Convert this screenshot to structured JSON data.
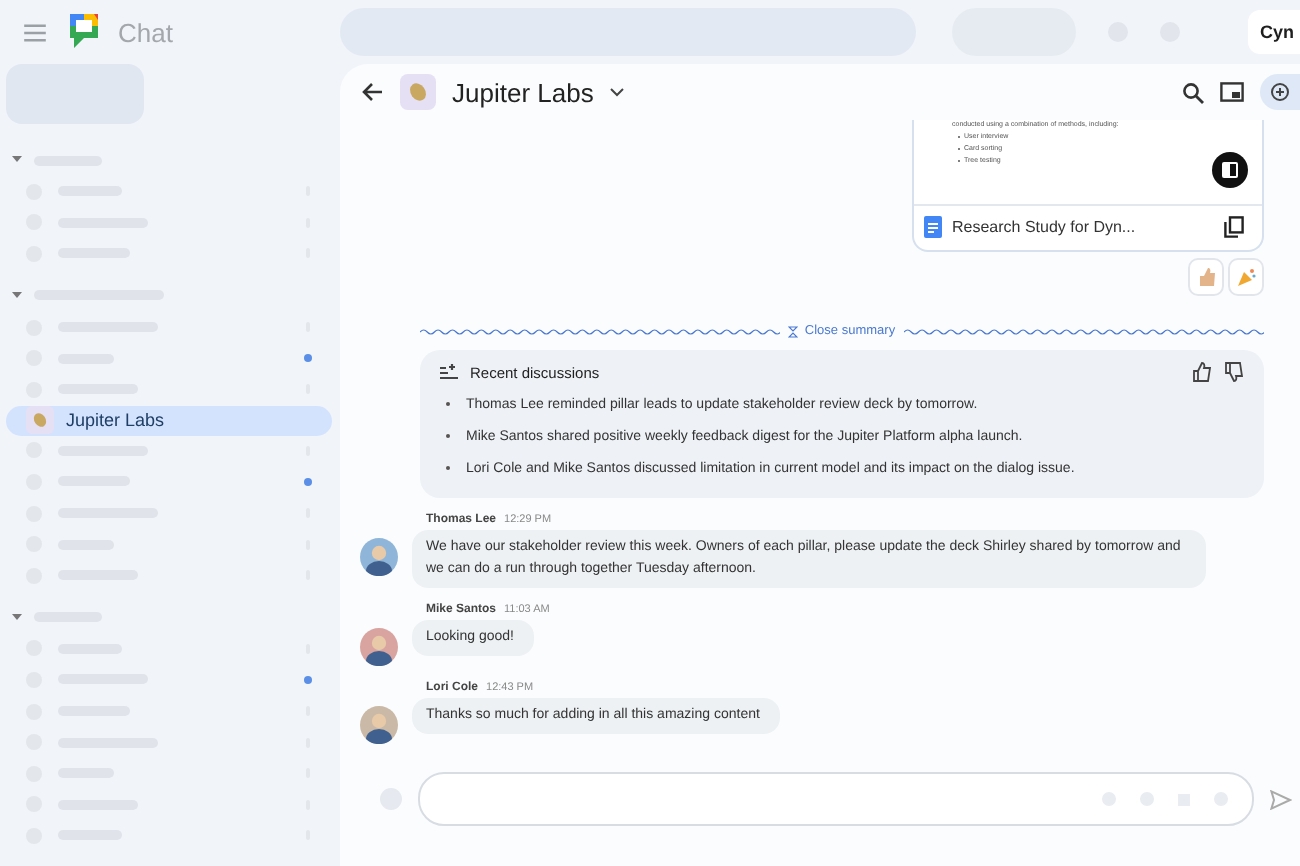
{
  "app": {
    "name": "Chat",
    "account_tab": "Cyn"
  },
  "sidebar": {
    "sections": [
      {
        "items": [
          {
            "kind": "placeholder",
            "unread": false
          },
          {
            "kind": "placeholder",
            "unread": false
          },
          {
            "kind": "placeholder",
            "unread": false
          }
        ]
      },
      {
        "items": [
          {
            "kind": "placeholder",
            "unread": false
          },
          {
            "kind": "placeholder",
            "unread": true
          },
          {
            "kind": "placeholder",
            "unread": false
          },
          {
            "kind": "space",
            "label": "Jupiter Labs",
            "selected": true
          },
          {
            "kind": "placeholder",
            "unread": false
          },
          {
            "kind": "placeholder",
            "unread": true
          },
          {
            "kind": "placeholder",
            "unread": false
          },
          {
            "kind": "placeholder",
            "unread": false
          },
          {
            "kind": "placeholder",
            "unread": false
          }
        ]
      },
      {
        "items": [
          {
            "kind": "placeholder",
            "unread": false
          },
          {
            "kind": "placeholder",
            "unread": true
          },
          {
            "kind": "placeholder",
            "unread": false
          },
          {
            "kind": "placeholder",
            "unread": false
          },
          {
            "kind": "placeholder",
            "unread": false
          },
          {
            "kind": "placeholder",
            "unread": false
          },
          {
            "kind": "placeholder",
            "unread": false
          }
        ]
      }
    ]
  },
  "header": {
    "title": "Jupiter Labs"
  },
  "doc_card": {
    "intro": "conducted using a combination of methods, including:",
    "bullets": [
      "User interview",
      "Card sorting",
      "Tree testing"
    ],
    "file_name": "Research Study for Dyn..."
  },
  "summary": {
    "toggle": "Close summary",
    "title": "Recent discussions",
    "points": [
      "Thomas Lee reminded pillar leads to update stakeholder review deck by tomorrow.",
      "Mike Santos shared positive weekly feedback digest for the Jupiter Platform alpha launch.",
      "Lori Cole and Mike Santos discussed limitation in current model and its impact on the dialog issue."
    ]
  },
  "messages": [
    {
      "author": "Thomas Lee",
      "time": "12:29 PM",
      "text": "We have our stakeholder review this week. Owners of each pillar, please update the deck Shirley shared by tomorrow and we can do a run through together Tuesday afternoon."
    },
    {
      "author": "Mike Santos",
      "time": "11:03 AM",
      "text": "Looking good!"
    },
    {
      "author": "Lori Cole",
      "time": "12:43 PM",
      "text": "Thanks so much for adding in all this amazing content"
    }
  ]
}
